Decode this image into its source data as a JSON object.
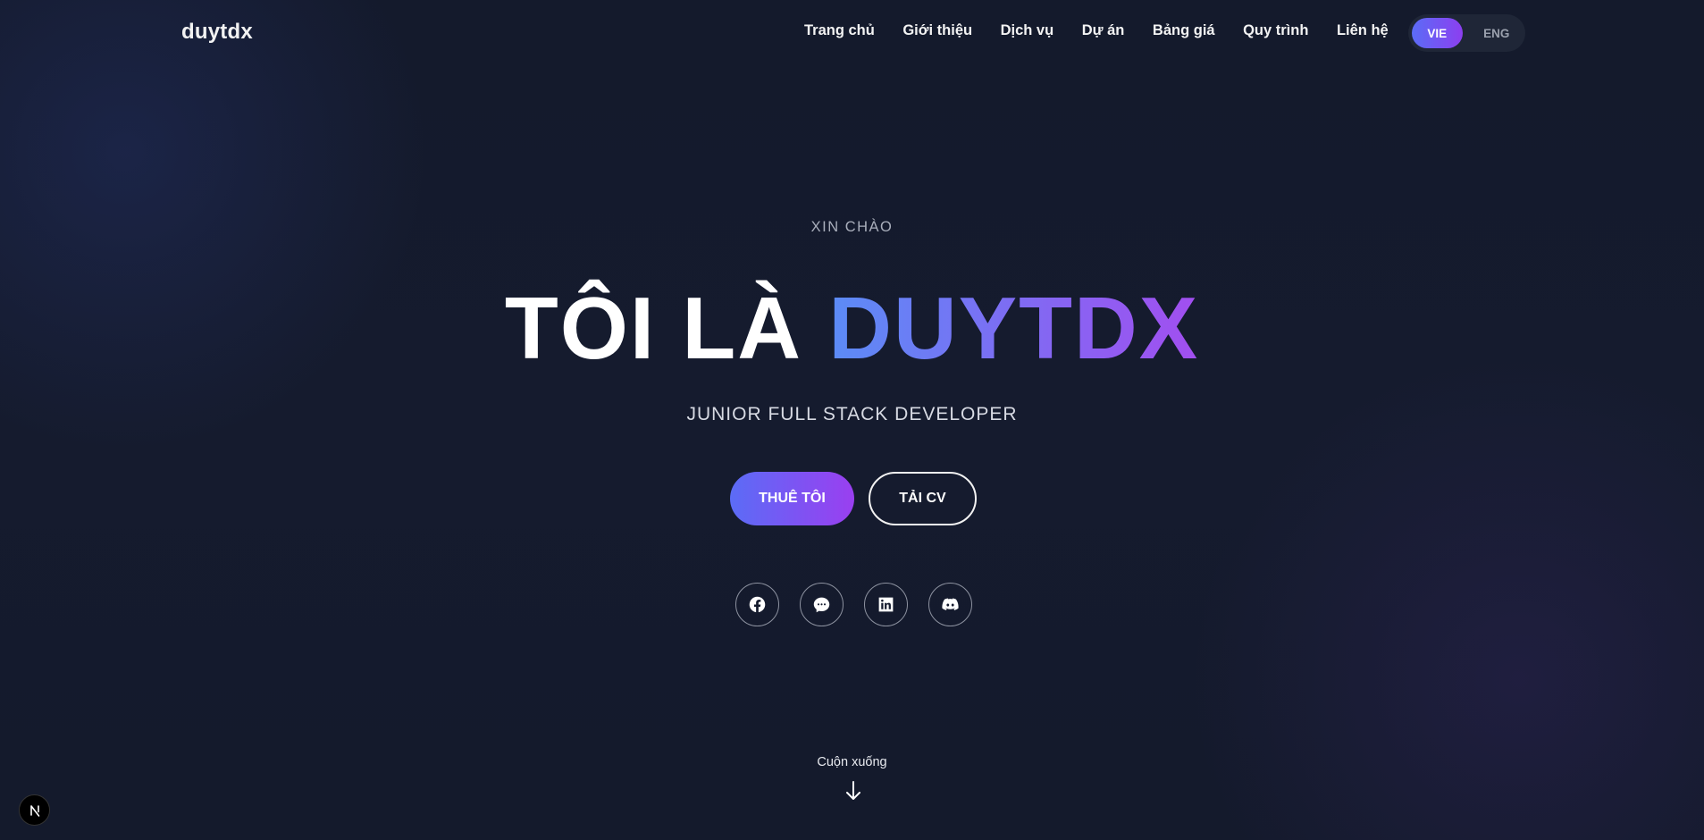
{
  "header": {
    "logo": "duytdx",
    "nav": [
      "Trang chủ",
      "Giới thiệu",
      "Dịch vụ",
      "Dự án",
      "Bảng giá",
      "Quy trình",
      "Liên hệ"
    ],
    "languages": [
      {
        "label": "VIE",
        "active": true
      },
      {
        "label": "ENG",
        "active": false
      }
    ]
  },
  "hero": {
    "greeting": "XIN CHÀO",
    "headline_plain": "TÔI LÀ",
    "headline_highlight": "DUYTDX",
    "role": "JUNIOR FULL STACK DEVELOPER",
    "primary_cta": "THUÊ TÔI",
    "secondary_cta": "TẢI CV",
    "socials": [
      "facebook-icon",
      "messenger-icon",
      "linkedin-icon",
      "discord-icon"
    ]
  },
  "scroll": {
    "label": "Cuộn xuống"
  },
  "colors": {
    "background": "#151b2e",
    "accent_start": "#5b6cf6",
    "accent_end": "#9a3ff0"
  }
}
